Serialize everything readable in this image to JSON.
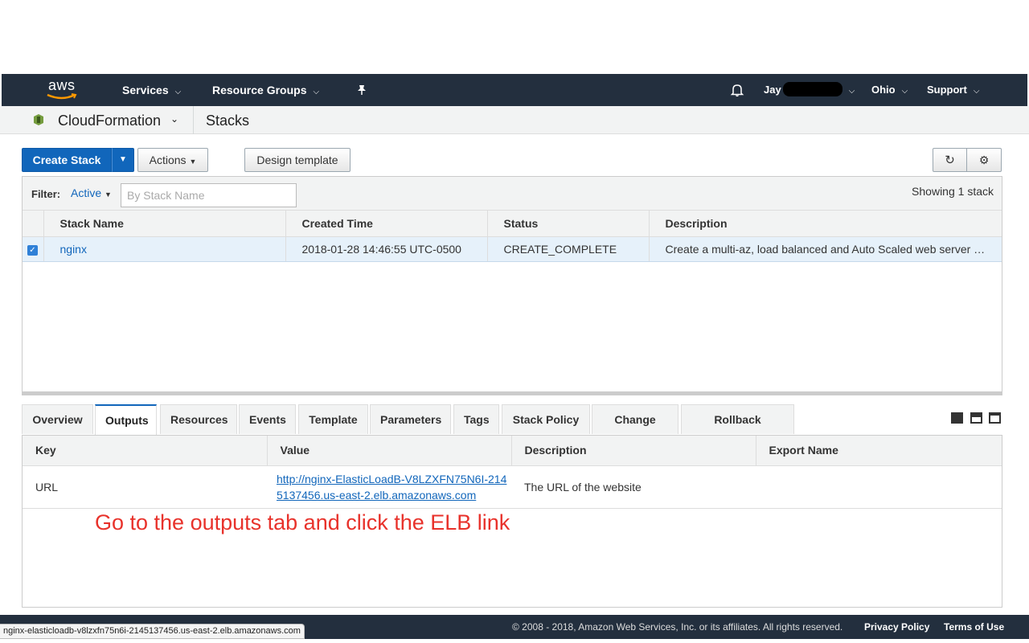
{
  "nav": {
    "logo_text": "aws",
    "services": "Services",
    "resource_groups": "Resource Groups",
    "user": "Jay",
    "region": "Ohio",
    "support": "Support"
  },
  "subbar": {
    "service": "CloudFormation",
    "page": "Stacks"
  },
  "toolbar": {
    "create_stack": "Create Stack",
    "actions": "Actions",
    "design_template": "Design template"
  },
  "filter": {
    "label": "Filter:",
    "value": "Active",
    "placeholder": "By Stack Name",
    "showing": "Showing 1 stack"
  },
  "stack_table": {
    "headers": [
      "Stack Name",
      "Created Time",
      "Status",
      "Description"
    ],
    "rows": [
      {
        "checked": true,
        "name": "nginx",
        "created": "2018-01-28 14:46:55 UTC-0500",
        "status": "CREATE_COMPLETE",
        "description": "Create a multi-az, load balanced and Auto Scaled web server …"
      }
    ]
  },
  "tabs": [
    "Overview",
    "Outputs",
    "Resources",
    "Events",
    "Template",
    "Parameters",
    "Tags",
    "Stack Policy",
    "Change Sets",
    "Rollback Triggers"
  ],
  "active_tab": "Outputs",
  "outputs_table": {
    "headers": [
      "Key",
      "Value",
      "Description",
      "Export Name"
    ],
    "rows": [
      {
        "key": "URL",
        "value": "http://nginx-ElasticLoadB-V8LZXFN75N6I-2145137456.us-east-2.elb.amazonaws.com",
        "description": "The URL of the website",
        "export_name": ""
      }
    ]
  },
  "annotation": "Go to the outputs tab and click the ELB link",
  "footer": {
    "copyright": "© 2008 - 2018, Amazon Web Services, Inc. or its affiliates. All rights reserved.",
    "privacy": "Privacy Policy",
    "terms": "Terms of Use"
  },
  "status_bar_url": "nginx-elasticloadb-v8lzxfn75n6i-2145137456.us-east-2.elb.amazonaws.com",
  "colors": {
    "nav_bg": "#232f3e",
    "primary": "#1166bb",
    "status_ok": "#1d8102",
    "annotation": "#e8322b"
  }
}
